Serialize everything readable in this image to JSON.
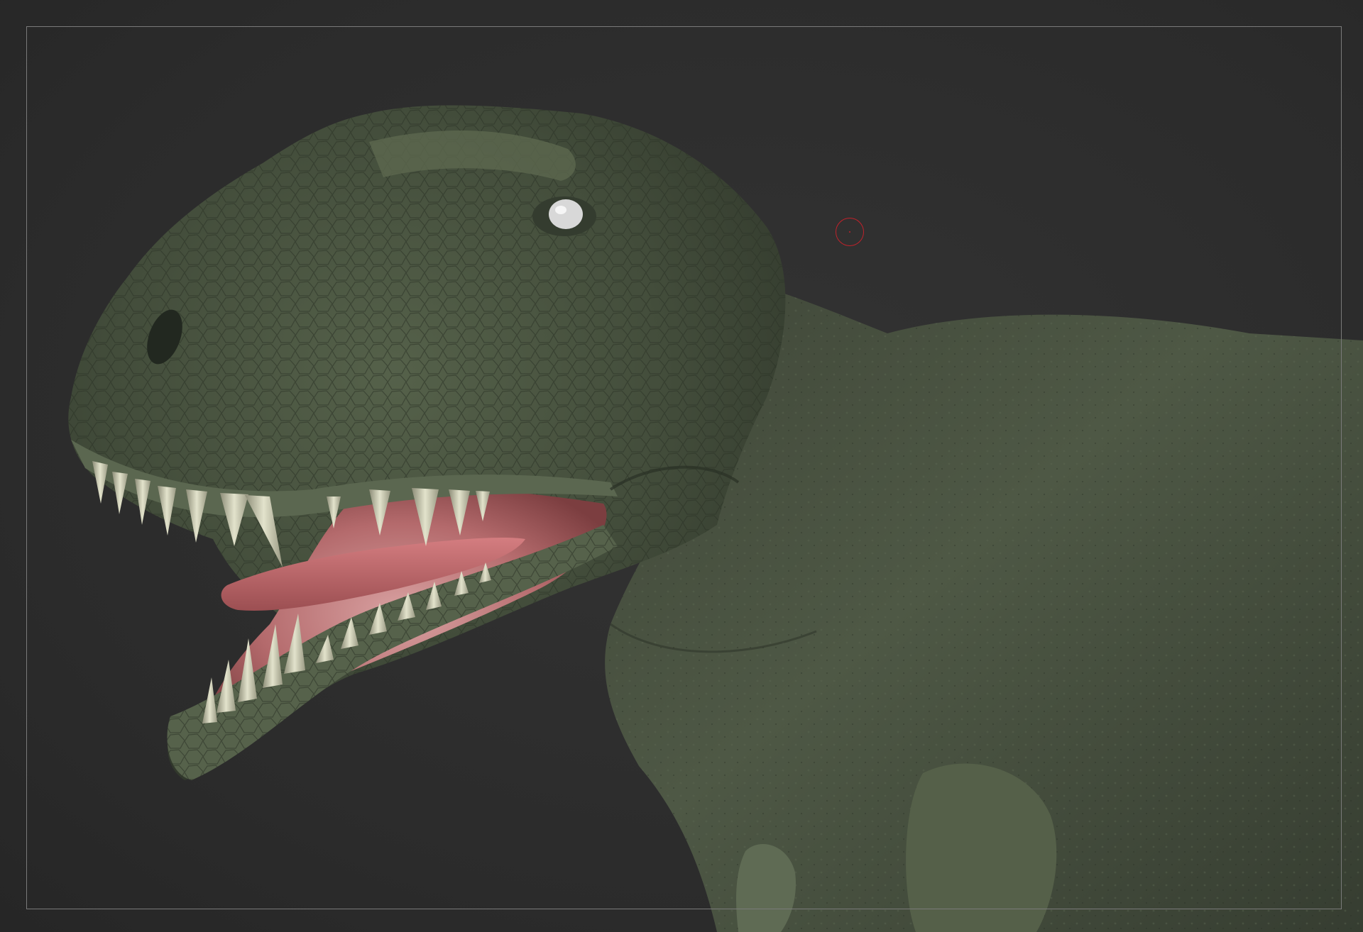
{
  "viewport": {
    "background": "#2d2d2d",
    "frame_border_color": "#7a7a7a"
  },
  "model": {
    "subject": "tyrannosaurus-head-sculpt",
    "skin_color": "#4a5541",
    "skin_highlight": "#6b7a5e",
    "mouth_color": "#b86a6c",
    "tongue_color": "#c1676a",
    "teeth_color": "#c9c9b0",
    "eye_color": "#d9d9d9"
  },
  "brush": {
    "icon": "brush-cursor-icon",
    "color": "#c0222b"
  }
}
